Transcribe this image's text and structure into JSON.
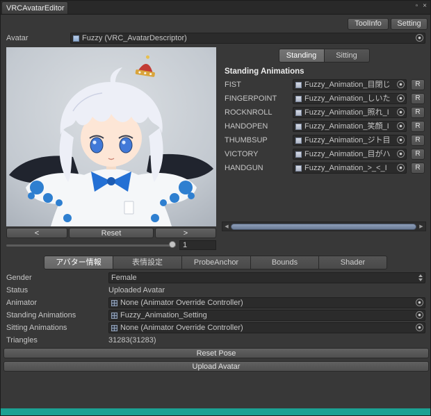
{
  "window": {
    "tab_title": "VRCAvatarEditor"
  },
  "icons": {
    "minimize": "▫",
    "close": "×",
    "scroll_left": "◀",
    "scroll_right": "▶"
  },
  "toolbar": {
    "toolinfo": "ToolInfo",
    "setting": "Setting"
  },
  "avatar_field": {
    "label": "Avatar",
    "value": "Fuzzy (VRC_AvatarDescriptor)"
  },
  "preview": {
    "prev": "<",
    "reset": "Reset",
    "next": ">",
    "zoom_value": "1"
  },
  "animations": {
    "tabs": [
      {
        "label": "Standing"
      },
      {
        "label": "Sitting"
      }
    ],
    "header": "Standing Animations",
    "reset_label": "R",
    "rows": [
      {
        "label": "FIST",
        "value": "Fuzzy_Animation_目閉じ"
      },
      {
        "label": "FINGERPOINT",
        "value": "Fuzzy_Animation_しいた"
      },
      {
        "label": "ROCKNROLL",
        "value": "Fuzzy_Animation_照れ_I"
      },
      {
        "label": "HANDOPEN",
        "value": "Fuzzy_Animation_笑顔_I"
      },
      {
        "label": "THUMBSUP",
        "value": "Fuzzy_Animation_ジト目"
      },
      {
        "label": "VICTORY",
        "value": "Fuzzy_Animation_目がハ"
      },
      {
        "label": "HANDGUN",
        "value": "Fuzzy_Animation_>_<_I"
      }
    ]
  },
  "info_tabs": [
    "アバター情報",
    "表情設定",
    "ProbeAnchor",
    "Bounds",
    "Shader"
  ],
  "info": {
    "gender": {
      "label": "Gender",
      "value": "Female"
    },
    "status": {
      "label": "Status",
      "value": "Uploaded Avatar"
    },
    "animator": {
      "label": "Animator",
      "value": "None (Animator Override Controller)"
    },
    "standing": {
      "label": "Standing Animations",
      "value": "Fuzzy_Animation_Setting"
    },
    "sitting": {
      "label": "Sitting Animations",
      "value": "None (Animator Override Controller)"
    },
    "triangles": {
      "label": "Triangles",
      "value": "31283(31283)"
    }
  },
  "actions": {
    "reset_pose": "Reset Pose",
    "upload_avatar": "Upload Avatar"
  },
  "colors": {
    "accent_blue": "#2e7fd0",
    "thumb_blue": "#7b8ca6",
    "teal_strip": "#1ba193"
  }
}
